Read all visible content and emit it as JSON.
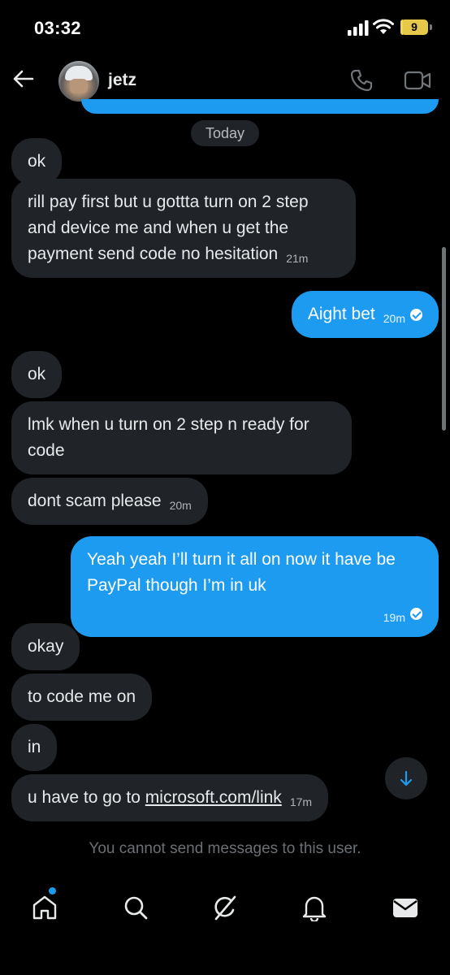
{
  "status_bar": {
    "time": "03:32",
    "battery_level": "9",
    "battery_fraction": 0.09
  },
  "header": {
    "back_icon": "arrow-left-icon",
    "contact_name": "jetz",
    "call_icon": "phone-icon",
    "video_icon": "video-camera-icon"
  },
  "chat": {
    "date_label": "Today",
    "messages": [
      {
        "direction": "in",
        "text": "ok",
        "timestamp": ""
      },
      {
        "direction": "in",
        "text": "rill pay first but u gottta turn on 2 step and device me and when u get the payment send code no hesitation",
        "timestamp": "21m"
      },
      {
        "direction": "out",
        "text": "Aight bet",
        "timestamp": "20m",
        "read": true
      },
      {
        "direction": "in",
        "text": "ok",
        "timestamp": ""
      },
      {
        "direction": "in",
        "text": "lmk when u turn on 2 step n ready for code",
        "timestamp": ""
      },
      {
        "direction": "in",
        "text": "dont scam please",
        "timestamp": "20m"
      },
      {
        "direction": "out",
        "text": "Yeah yeah I’ll turn it all on now it have be PayPal though I’m in uk",
        "timestamp": "19m",
        "read": true
      },
      {
        "direction": "in",
        "text": "okay",
        "timestamp": ""
      },
      {
        "direction": "in",
        "text": "to code me on",
        "timestamp": ""
      },
      {
        "direction": "in",
        "text": "in",
        "timestamp": ""
      },
      {
        "direction": "in",
        "text_prefix": "u have to go to ",
        "link": "microsoft.com/link",
        "timestamp": "17m"
      }
    ],
    "scroll_down_icon": "arrow-down-icon"
  },
  "notice": "You cannot send messages to this user.",
  "bottom_nav": {
    "items": [
      {
        "name": "home",
        "icon": "home-icon",
        "has_notification_dot": true
      },
      {
        "name": "search",
        "icon": "search-icon"
      },
      {
        "name": "grok",
        "icon": "grok-slash-icon"
      },
      {
        "name": "notifications",
        "icon": "bell-icon"
      },
      {
        "name": "messages",
        "icon": "envelope-icon",
        "active": true
      }
    ]
  },
  "colors": {
    "background": "#000000",
    "incoming_bubble": "#202327",
    "outgoing_bubble": "#1d9bf0",
    "accent": "#1d9bf0",
    "battery": "#f5d74c"
  }
}
